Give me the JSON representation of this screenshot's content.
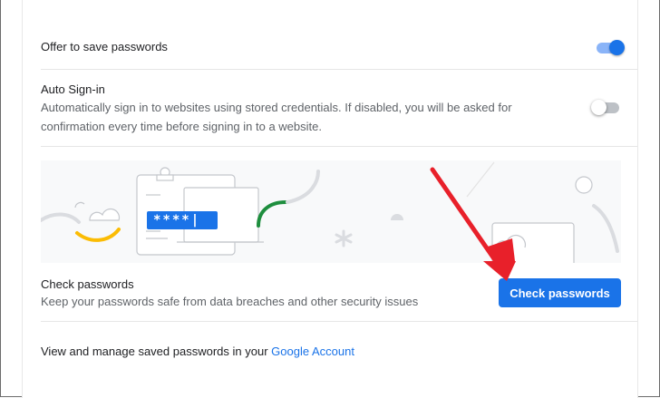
{
  "offer_save": {
    "label": "Offer to save passwords",
    "enabled": true
  },
  "auto_signin": {
    "title": "Auto Sign-in",
    "description": "Automatically sign in to websites using stored credentials. If disabled, you will be asked for confirmation every time before signing in to a website.",
    "enabled": false
  },
  "illustration": {
    "password_mask": "****|"
  },
  "check_passwords": {
    "title": "Check passwords",
    "description": "Keep your passwords safe from data breaches and other security issues",
    "button_label": "Check passwords"
  },
  "footer": {
    "text": "View and manage saved passwords in your ",
    "link_label": "Google Account"
  },
  "colors": {
    "accent": "#1a73e8",
    "annotation_arrow": "#e8202a",
    "illustration_green": "#1e8e3e",
    "illustration_yellow": "#fbbc04"
  }
}
